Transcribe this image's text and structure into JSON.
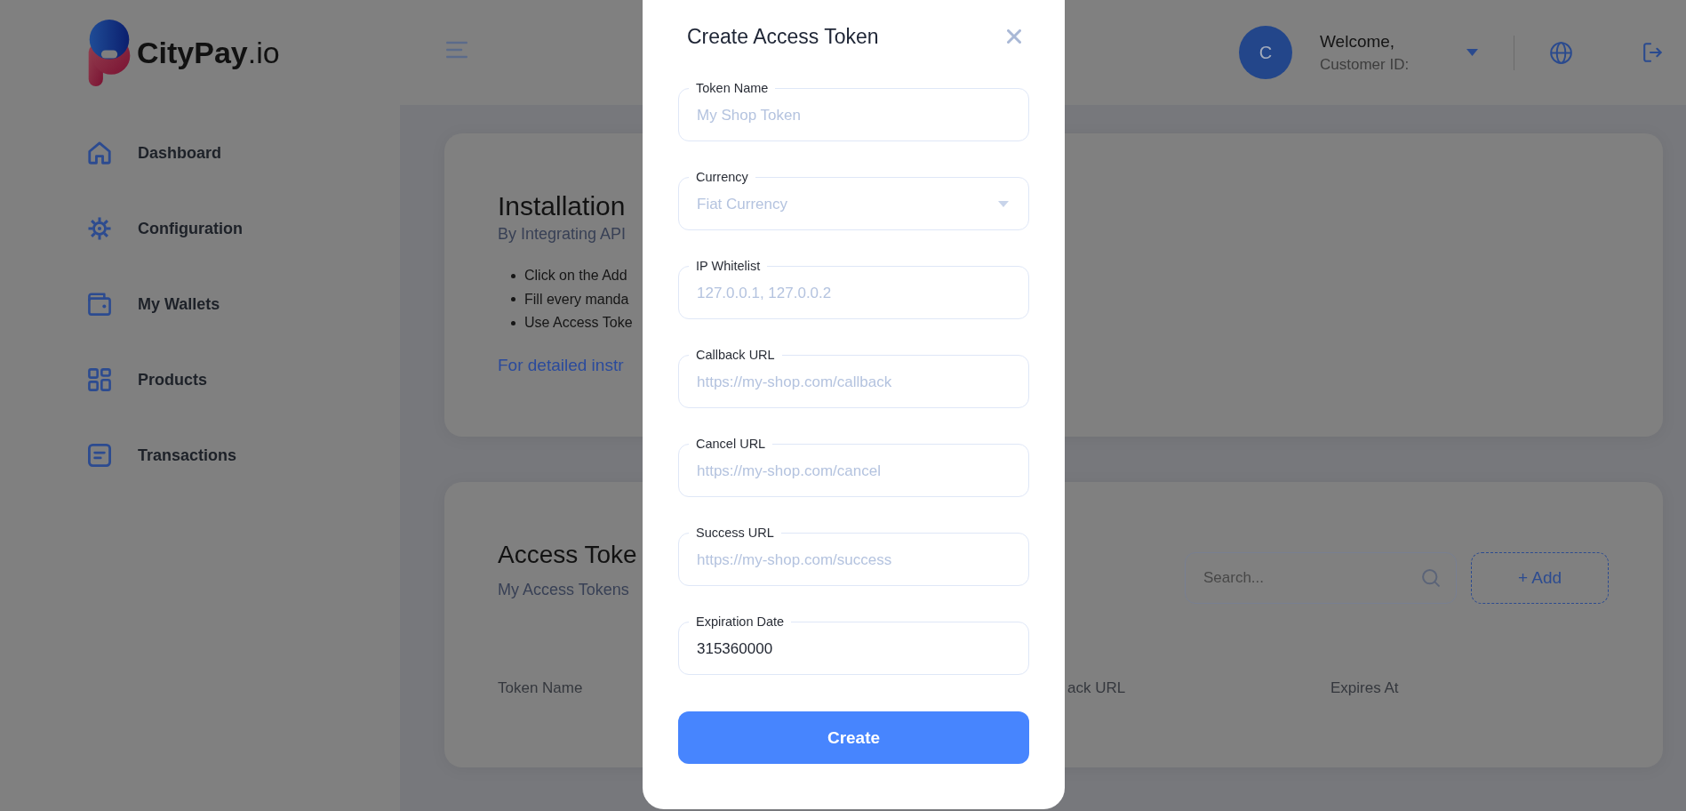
{
  "header": {
    "logo": "**CityPay**.io",
    "avatar_initial": "C",
    "greeting": "Welcome,",
    "customer_id_label": "Customer ID:"
  },
  "sidebar": {
    "items": [
      {
        "label": "Dashboard",
        "selected": false
      },
      {
        "label": "Configuration",
        "selected": false
      },
      {
        "label": "My Wallets",
        "selected": false
      },
      {
        "label": "Products",
        "selected": false
      },
      {
        "label": "Transactions",
        "selected": false
      }
    ]
  },
  "installation_card": {
    "title": "Installation",
    "subtitle": "By Integrating API",
    "steps": [
      "Click on the Add",
      "Fill every manda",
      "Use Access Toke"
    ],
    "link": "For detailed instr"
  },
  "tokens_card": {
    "title": "Access Toke",
    "subtitle": "My Access Tokens",
    "search": {
      "placeholder": "Search..."
    },
    "add_button": "+ Add",
    "table": {
      "columns": [
        "Token Name",
        "ack URL",
        "Expires At"
      ]
    }
  },
  "modal": {
    "title": "Create Access Token",
    "fields": [
      {
        "kind": "text",
        "label": "Token Name",
        "placeholder": "My Shop Token"
      },
      {
        "kind": "select",
        "label": "Currency",
        "placeholder": "Fiat Currency"
      },
      {
        "kind": "text",
        "label": "IP Whitelist",
        "placeholder": "127.0.0.1, 127.0.0.2"
      },
      {
        "kind": "text",
        "label": "Callback URL",
        "placeholder": "https://my-shop.com/callback"
      },
      {
        "kind": "text",
        "label": "Cancel URL",
        "placeholder": "https://my-shop.com/cancel"
      },
      {
        "kind": "text",
        "label": "Success URL",
        "placeholder": "https://my-shop.com/success"
      },
      {
        "kind": "text",
        "label": "Expiration Date",
        "value": "315360000"
      }
    ],
    "submit": "Create"
  }
}
